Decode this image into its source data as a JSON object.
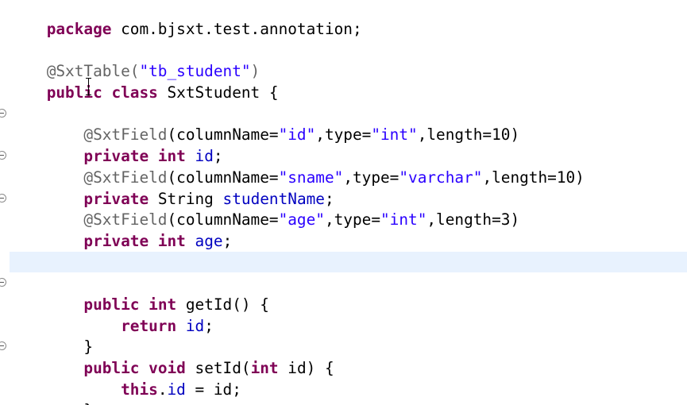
{
  "lines": {
    "l0": {
      "kw": "package",
      "rest": " com.bjsxt.test.annotation;"
    },
    "l2": {
      "ann": "@SxtTable(",
      "str": "\"tb_student\"",
      "ann2": ")"
    },
    "l3": {
      "kw1": "public",
      "sp1": " ",
      "kw2": "class",
      "rest": " SxtStudent {"
    },
    "l5": {
      "indent": "    ",
      "ann": "@SxtField",
      "t1": "(columnName=",
      "s1": "\"id\"",
      "t2": ",type=",
      "s2": "\"int\"",
      "t3": ",length=10)"
    },
    "l6": {
      "indent": "    ",
      "kw1": "private",
      "sp": " ",
      "kw2": "int",
      "sp2": " ",
      "fld": "id",
      "end": ";"
    },
    "l7": {
      "indent": "    ",
      "ann": "@SxtField",
      "t1": "(columnName=",
      "s1": "\"sname\"",
      "t2": ",type=",
      "s2": "\"varchar\"",
      "t3": ",length=10)"
    },
    "l8": {
      "indent": "    ",
      "kw1": "private",
      "rest": " String ",
      "fld": "studentName",
      "end": ";"
    },
    "l9": {
      "indent": "    ",
      "ann": "@SxtField",
      "t1": "(columnName=",
      "s1": "\"age\"",
      "t2": ",type=",
      "s2": "\"int\"",
      "t3": ",length=3)"
    },
    "l10": {
      "indent": "    ",
      "kw1": "private",
      "sp": " ",
      "kw2": "int",
      "sp2": " ",
      "fld": "age",
      "end": ";"
    },
    "l13": {
      "indent": "    ",
      "kw1": "public",
      "sp": " ",
      "kw2": "int",
      "rest": " getId() {"
    },
    "l14": {
      "indent": "        ",
      "kw": "return",
      "sp": " ",
      "fld": "id",
      "end": ";"
    },
    "l15": {
      "text": "    }"
    },
    "l16": {
      "indent": "    ",
      "kw1": "public",
      "sp": " ",
      "kw2": "void",
      "rest": " setId(",
      "kw3": "int",
      "rest2": " id) {"
    },
    "l17": {
      "indent": "        ",
      "kw": "this",
      "dot": ".",
      "fld": "id",
      "rest": " = id;"
    },
    "l18": {
      "text": "    }"
    }
  }
}
